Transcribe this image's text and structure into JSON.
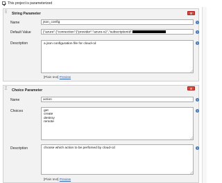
{
  "top": {
    "checkbox_label": "This project is parameterized"
  },
  "string_param": {
    "title": "String Parameter",
    "delete_label": "x",
    "name_label": "Name",
    "name_value": "json_config",
    "default_label": "Default Value",
    "default_value": "{\"azure\":{\"connection\":{\"provider\":\"azure-v2\",\"subscriptionId\":",
    "description_label": "Description",
    "description_value": "a json configuration file for cloud-cd",
    "plain_text_label": "[Plain text]",
    "preview_label": "Preview"
  },
  "choice_param": {
    "title": "Choice Parameter",
    "delete_label": "x",
    "name_label": "Name",
    "name_value": "action",
    "choices_label": "Choices",
    "choices_value": "get\ncreate\ndestroy\nremote",
    "description_label": "Description",
    "description_value": "choose which action to be perfomed by cloud-cd",
    "plain_text_label": "[Plain text]",
    "preview_label": "Preview"
  },
  "colors": {
    "delete_button": "#d24a3c",
    "help_icon": "#3a6fb0",
    "panel_bg": "#f2f2f2"
  },
  "icons": [
    "checkbox-checked-icon",
    "drag-handle-icon",
    "help-icon",
    "resize-handle-icon"
  ]
}
